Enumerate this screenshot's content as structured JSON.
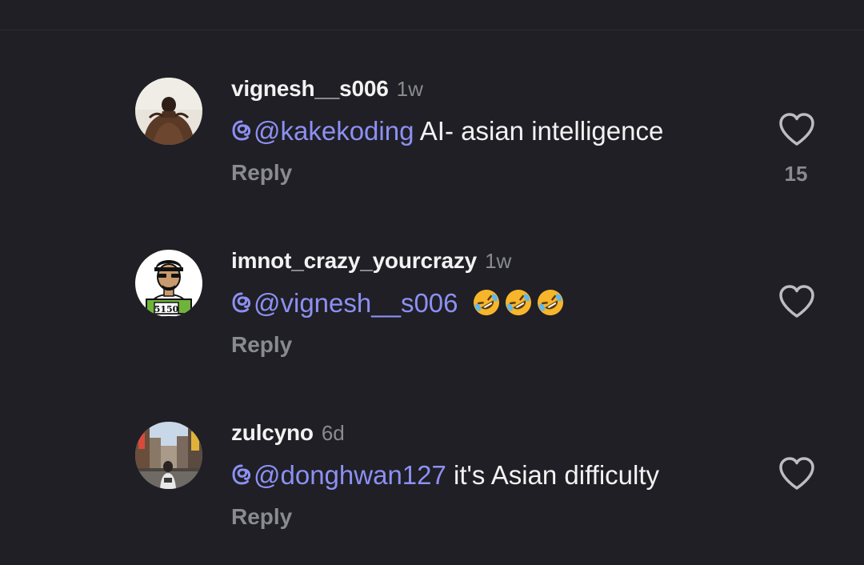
{
  "comments": [
    {
      "username": "vignesh__s006",
      "time": "1w",
      "mention": "@kakekoding",
      "text": " AI- asian intelligence",
      "reply_label": "Reply",
      "like_count": "15",
      "avatar": "shirtless-back-photo"
    },
    {
      "username": "imnot_crazy_yourcrazy",
      "time": "1w",
      "mention": "@vignesh__s006",
      "text": "",
      "emoji": [
        "rolling-on-floor-laughing",
        "rolling-on-floor-laughing",
        "rolling-on-floor-laughing"
      ],
      "reply_label": "Reply",
      "like_count": "",
      "avatar": "cartoon-man-5150"
    },
    {
      "username": "zulcyno",
      "time": "6d",
      "mention": "@donghwan127",
      "text": " it's Asian difficulty",
      "reply_label": "Reply",
      "like_count": "",
      "avatar": "city-street-photo"
    }
  ],
  "avatar_badge_text": "5150",
  "colors": {
    "background": "#1f1f25",
    "mention": "#8d90f2",
    "muted": "#8a8a92",
    "text": "#f2f2f2"
  },
  "icons": {
    "like": "heart-outline-icon",
    "mention": "threads-at-icon"
  }
}
